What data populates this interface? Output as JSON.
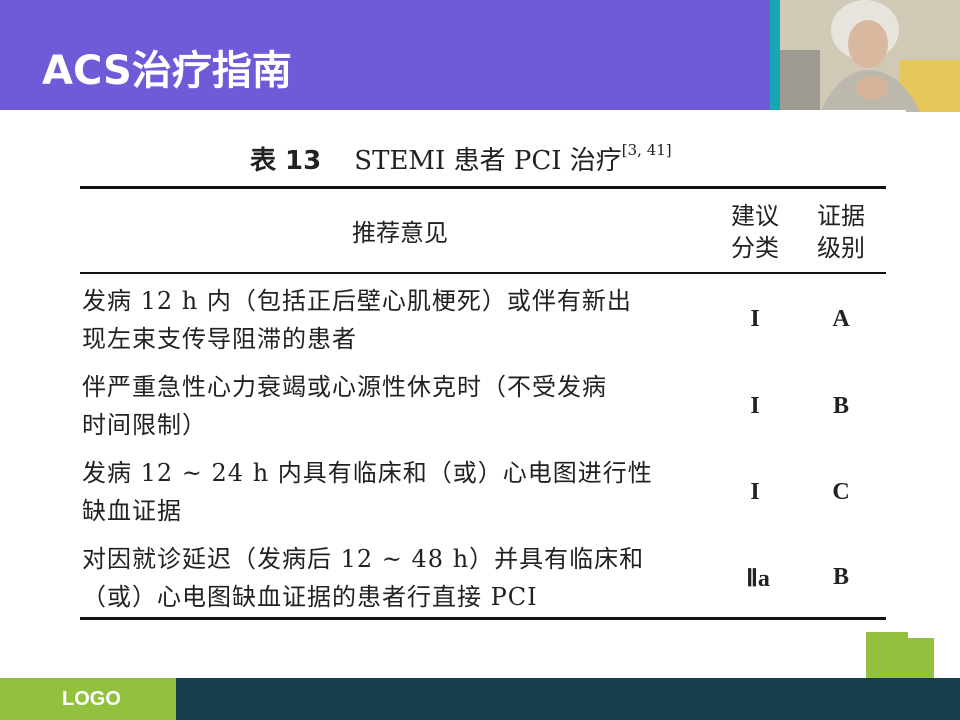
{
  "header": {
    "title": "ACS治疗指南"
  },
  "table": {
    "caption_num": "表 13",
    "caption_text": "STEMI 患者 PCI 治疗",
    "caption_ref": "[3, 41]",
    "columns": {
      "recommendation": "推荐意见",
      "class_line1": "建议",
      "class_line2": "分类",
      "level_line1": "证据",
      "level_line2": "级别"
    },
    "rows": [
      {
        "line1": "发病 12 h 内（包括正后壁心肌梗死）或伴有新出",
        "line2": "现左束支传导阻滞的患者",
        "class": "I",
        "level": "A"
      },
      {
        "line1": "伴严重急性心力衰竭或心源性休克时（不受发病",
        "line2": "时间限制）",
        "class": "I",
        "level": "B"
      },
      {
        "line1": "发病 12 ~ 24 h 内具有临床和（或）心电图进行性",
        "line2": "缺血证据",
        "class": "I",
        "level": "C"
      },
      {
        "line1": "对因就诊延迟（发病后 12 ~ 48 h）并具有临床和",
        "line2": "（或）心电图缺血证据的患者行直接 PCI",
        "class": "Ⅱa",
        "level": "B"
      }
    ]
  },
  "footer": {
    "logo": "LOGO"
  },
  "colors": {
    "header_band": "#6f5ad8",
    "teal_strip": "#15a7b5",
    "footer_bar": "#153f4f",
    "accent_green": "#93c13e"
  }
}
